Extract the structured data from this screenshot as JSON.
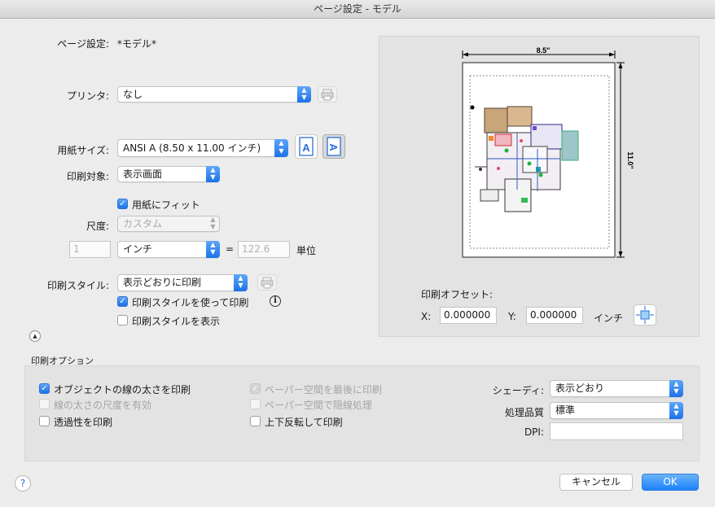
{
  "window": {
    "title": "ページ設定 - モデル"
  },
  "page_setup": {
    "label": "ページ設定:",
    "value": "*モデル*"
  },
  "printer": {
    "label": "プリンタ:",
    "value": "なし"
  },
  "paper_size": {
    "label": "用紙サイズ:",
    "value": "ANSI A (8.50 x 11.00 インチ)"
  },
  "plot_area": {
    "label": "印刷対象:",
    "value": "表示画面"
  },
  "fit_to_paper": {
    "label": "用紙にフィット",
    "checked": true
  },
  "scale": {
    "label": "尺度:",
    "value": "カスタム"
  },
  "scale_units": {
    "left_value": "1",
    "unit": "インチ",
    "equals": "=",
    "right_value": "122.6",
    "right_label": "単位"
  },
  "plot_style": {
    "label": "印刷スタイル:",
    "value": "表示どおりに印刷"
  },
  "use_plot_style": {
    "label": "印刷スタイルを使って印刷",
    "checked": true
  },
  "show_plot_style": {
    "label": "印刷スタイルを表示",
    "checked": false
  },
  "preview": {
    "width_label": "8.5\"",
    "height_label": "11.0\""
  },
  "offset": {
    "label": "印刷オフセット:",
    "x_label": "X:",
    "x_value": "0.000000",
    "y_label": "Y:",
    "y_value": "0.000000",
    "unit": "インチ"
  },
  "print_options": {
    "heading": "印刷オプション",
    "col1": [
      {
        "label": "オブジェクトの線の太さを印刷",
        "checked": true,
        "enabled": true
      },
      {
        "label": "線の太さの尺度を有効",
        "checked": false,
        "enabled": false
      },
      {
        "label": "透過性を印刷",
        "checked": false,
        "enabled": true
      }
    ],
    "col2": [
      {
        "label": "ペーパー空間を最後に印刷",
        "checked": true,
        "enabled": false
      },
      {
        "label": "ペーパー空間で隠線処理",
        "checked": false,
        "enabled": false
      },
      {
        "label": "上下反転して印刷",
        "checked": false,
        "enabled": true
      }
    ],
    "shading": {
      "label": "シェーディ:",
      "value": "表示どおり"
    },
    "quality": {
      "label": "処理品質",
      "value": "標準"
    },
    "dpi": {
      "label": "DPI:",
      "value": ""
    }
  },
  "buttons": {
    "help": "?",
    "cancel": "キャンセル",
    "ok": "OK"
  },
  "colors": {
    "accent": "#1a82fb"
  }
}
